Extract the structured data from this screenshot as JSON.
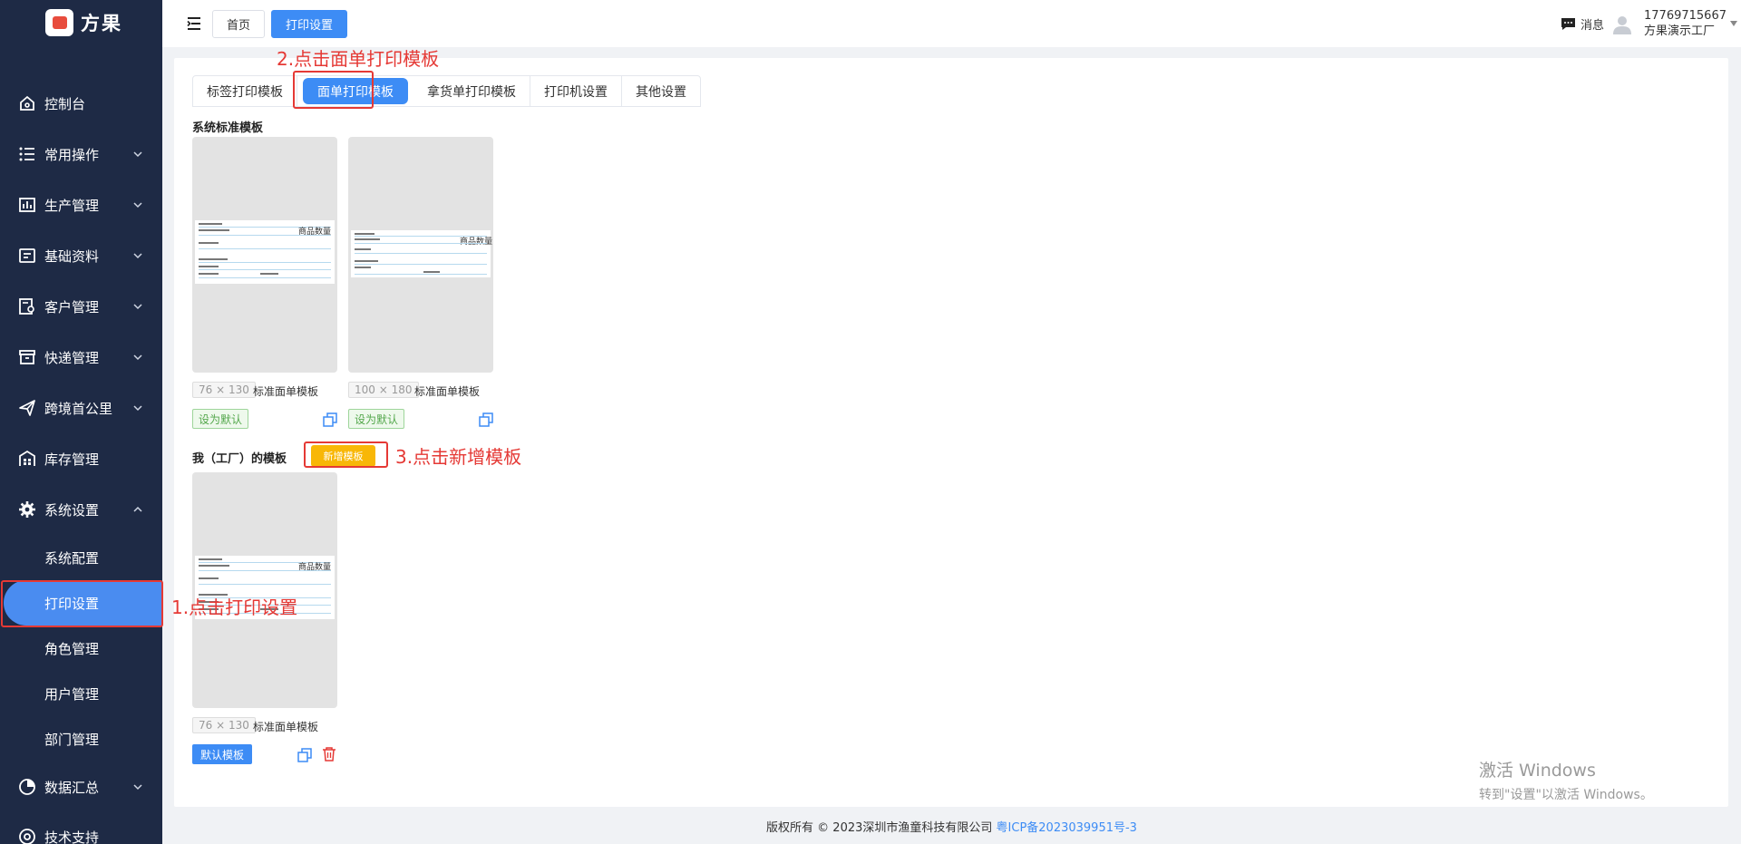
{
  "brand": {
    "name": "方果",
    "logo_color": "#e84c3d"
  },
  "sidebar": {
    "items": [
      {
        "label": "控制台",
        "icon": "home-icon"
      },
      {
        "label": "常用操作",
        "icon": "list-icon"
      },
      {
        "label": "生产管理",
        "icon": "chart-icon"
      },
      {
        "label": "基础资料",
        "icon": "folder-icon"
      },
      {
        "label": "客户管理",
        "icon": "customer-icon"
      },
      {
        "label": "快递管理",
        "icon": "box-icon"
      },
      {
        "label": "跨境首公里",
        "icon": "send-icon"
      },
      {
        "label": "库存管理",
        "icon": "warehouse-icon"
      },
      {
        "label": "系统设置",
        "icon": "gear-icon"
      }
    ],
    "sub_items": [
      "系统配置",
      "打印设置",
      "角色管理",
      "用户管理",
      "部门管理"
    ],
    "bottom_items": [
      {
        "label": "数据汇总",
        "icon": "pie-icon"
      },
      {
        "label": "技术支持",
        "icon": "support-icon"
      }
    ],
    "bg_color": "#1e2a45",
    "active_color": "#4a8cf0"
  },
  "header": {
    "tabs": [
      "首页",
      "打印设置"
    ],
    "message_label": "消息",
    "user_phone": "17769715667",
    "user_org": "方果演示工厂"
  },
  "template_tabs": [
    "标签打印模板",
    "面单打印模板",
    "拿货单打印模板",
    "打印机设置",
    "其他设置"
  ],
  "system_section": {
    "title": "系统标准模板",
    "cards": [
      {
        "size": "76 × 130",
        "name": "标准面单模板",
        "button": "设为默认"
      },
      {
        "size": "100 × 180",
        "name": "标准面单模板",
        "button": "设为默认"
      }
    ]
  },
  "my_section": {
    "title": "我（工厂）的模板",
    "add_button": "新增模板",
    "cards": [
      {
        "size": "76 × 130",
        "name": "标准面单模板",
        "button": "默认模板"
      }
    ]
  },
  "receipt_heading": "商品数量",
  "annotations": {
    "step1": "1.点击打印设置",
    "step2": "2.点击面单打印模板",
    "step3": "3.点击新增模板"
  },
  "footer": {
    "text": "版权所有 © 2023深圳市渔童科技有限公司",
    "icp": "粤ICP备2023039951号-3"
  },
  "watermark": {
    "line1": "激活 Windows",
    "line2": "转到\"设置\"以激活 Windows。"
  }
}
